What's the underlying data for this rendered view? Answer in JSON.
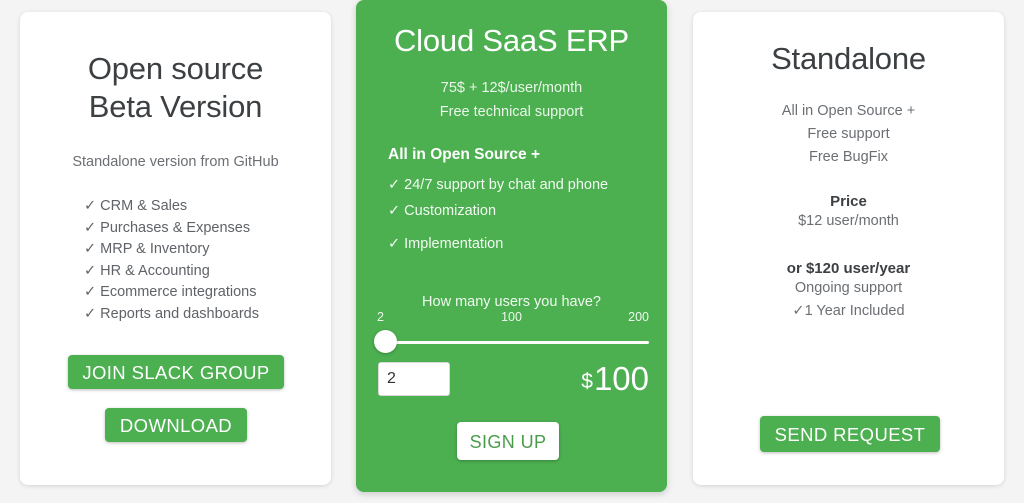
{
  "theme": {
    "page_background": "#f4f4f4",
    "accent_green": "#4caf50",
    "card_white": "#ffffff",
    "text_dark": "#3c4043",
    "text_muted": "#6b6f73"
  },
  "plans": {
    "open_source": {
      "title_line1": "Open source",
      "title_line2": "Beta Version",
      "subtitle": "Standalone version from GitHub",
      "features": [
        "CRM & Sales",
        "Purchases & Expenses",
        "MRP & Inventory",
        "HR & Accounting",
        "Ecommerce integrations",
        "Reports and dashboards"
      ],
      "primary_button": "JOIN SLACK GROUP",
      "secondary_button": "DOWNLOAD"
    },
    "cloud_saas": {
      "title": "Cloud SaaS ERP",
      "price_line": "75$ + 12$/user/month",
      "support_line": "Free technical support",
      "section_heading": "All in Open Source +",
      "features": [
        "24/7 support by chat and phone",
        "Customization",
        "Implementation"
      ],
      "slider_question": "How many users you have?",
      "slider": {
        "min_label": "2",
        "mid_label": "100",
        "max_label": "200",
        "min": 2,
        "max": 200,
        "value": 2
      },
      "quantity_value": "2",
      "quantity_placeholder": "2",
      "total_currency": "$",
      "total_amount": "100",
      "signup_button": "SIGN UP"
    },
    "standalone": {
      "title": "Standalone",
      "subtitle_lines": [
        "All in Open Source +",
        "Free support",
        "Free BugFix"
      ],
      "price_heading": "Price",
      "price_monthly": "$12 user/month",
      "price_yearly": "or $120 user/year",
      "extra_lines": [
        "Ongoing support",
        "✓1 Year Included"
      ],
      "request_button": "SEND REQUEST"
    }
  },
  "icons": {
    "check": "✓"
  }
}
